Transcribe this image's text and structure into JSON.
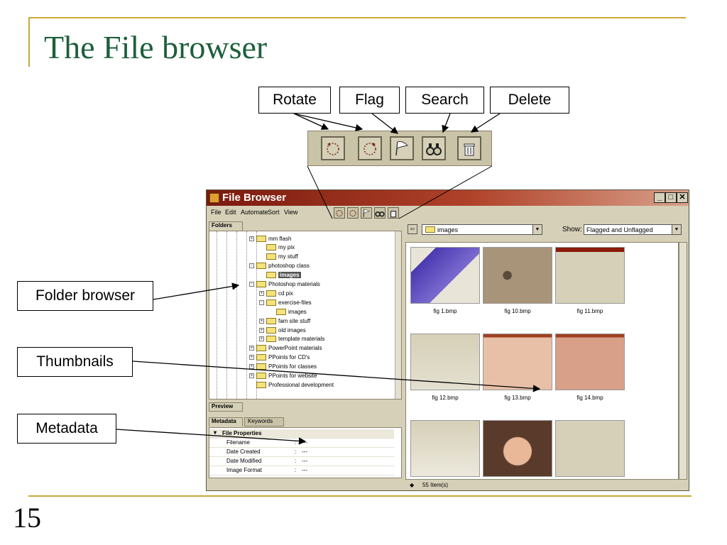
{
  "slide": {
    "title": "The File browser",
    "number": "15"
  },
  "callouts": {
    "rotate": "Rotate",
    "flag": "Flag",
    "search": "Search",
    "delete": "Delete",
    "folder_browser": "Folder browser",
    "thumbnails": "Thumbnails",
    "metadata": "Metadata"
  },
  "toolbar_icons": [
    "rotate-left-icon",
    "rotate-right-icon",
    "flag-icon",
    "binoculars-icon",
    "trash-icon"
  ],
  "window": {
    "title": "File Browser",
    "controls": {
      "minimize": "_",
      "maximize": "□",
      "close": "✕"
    },
    "menu": [
      "File",
      "Edit",
      "Automate",
      "Sort",
      "View"
    ]
  },
  "folders_panel": {
    "tab": "Folders",
    "tree": [
      {
        "label": "mm flash",
        "expander": "+"
      },
      {
        "label": "my pix",
        "expander": ""
      },
      {
        "label": "my stuff",
        "expander": ""
      },
      {
        "label": "photoshop class",
        "expander": "-"
      },
      {
        "label": "images",
        "expander": "",
        "selected": true
      },
      {
        "label": "Photoshop materials",
        "expander": "-"
      },
      {
        "label": "cd pix",
        "expander": "+"
      },
      {
        "label": "exercise-files",
        "expander": "-"
      },
      {
        "label": "images",
        "expander": ""
      },
      {
        "label": "fam site stuff",
        "expander": "+"
      },
      {
        "label": "old images",
        "expander": "+"
      },
      {
        "label": "template materials",
        "expander": "+"
      },
      {
        "label": "PowerPoint materials",
        "expander": "+"
      },
      {
        "label": "PPoints for CD's",
        "expander": "+"
      },
      {
        "label": "PPoints for classes",
        "expander": "+"
      },
      {
        "label": "PPoints for website",
        "expander": "+"
      },
      {
        "label": "Professional development",
        "expander": ""
      }
    ]
  },
  "preview_panel": {
    "tab": "Preview"
  },
  "metadata_panel": {
    "tabs": [
      "Metadata",
      "Keywords"
    ],
    "section": "File Properties",
    "rows": [
      {
        "key": "Filename",
        "sep": ":",
        "value": "---"
      },
      {
        "key": "Date Created",
        "sep": ":",
        "value": "---"
      },
      {
        "key": "Date Modified",
        "sep": ":",
        "value": "---"
      },
      {
        "key": "Image Format",
        "sep": ":",
        "value": "---"
      }
    ]
  },
  "browser": {
    "path": "images",
    "show_label": "Show:",
    "show_value": "Flagged and Unflagged",
    "thumbnails": [
      {
        "label": "fig 1.bmp"
      },
      {
        "label": "fig 10.bmp"
      },
      {
        "label": "fig 11.bmp"
      },
      {
        "label": "fig 12.bmp"
      },
      {
        "label": "fig 13.bmp"
      },
      {
        "label": "fig 14.bmp"
      },
      {
        "label": ""
      },
      {
        "label": ""
      },
      {
        "label": ""
      }
    ],
    "status": "55 Item(s)"
  }
}
